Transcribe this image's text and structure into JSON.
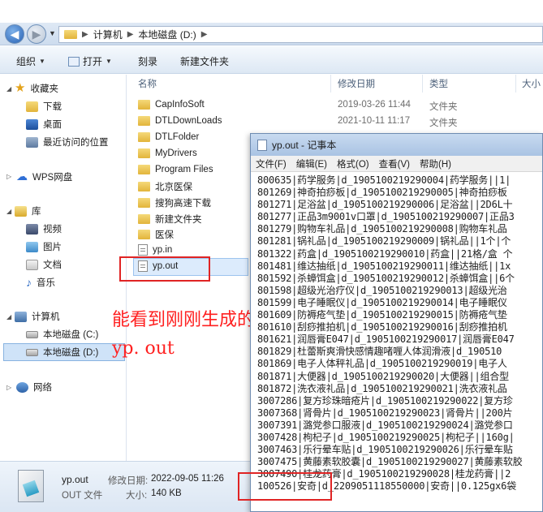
{
  "address": {
    "crumb1": "计算机",
    "crumb2": "本地磁盘 (D:)"
  },
  "toolbar": {
    "organize": "组织",
    "open": "打开",
    "burn": "刻录",
    "new_folder": "新建文件夹"
  },
  "nav": {
    "favorites": "收藏夹",
    "downloads": "下载",
    "desktop": "桌面",
    "recent": "最近访问的位置",
    "wps": "WPS网盘",
    "library": "库",
    "videos": "视频",
    "pictures": "图片",
    "documents": "文档",
    "music": "音乐",
    "computer": "计算机",
    "drive_c": "本地磁盘 (C:)",
    "drive_d": "本地磁盘 (D:)",
    "network": "网络"
  },
  "columns": {
    "name": "名称",
    "date": "修改日期",
    "type": "类型",
    "size": "大小"
  },
  "files": [
    {
      "name": "CapInfoSoft",
      "date": "2019-03-26 11:44",
      "type": "文件夹"
    },
    {
      "name": "DTLDownLoads",
      "date": "2021-10-11 11:17",
      "type": "文件夹"
    },
    {
      "name": "DTLFolder"
    },
    {
      "name": "MyDrivers"
    },
    {
      "name": "Program Files"
    },
    {
      "name": "北京医保"
    },
    {
      "name": "搜狗高速下载"
    },
    {
      "name": "新建文件夹"
    },
    {
      "name": "医保"
    },
    {
      "name": "yp.in"
    },
    {
      "name": "yp.out"
    }
  ],
  "annotation": {
    "line1": "能看到刚刚生成的文件",
    "line2": "yp. out"
  },
  "status": {
    "filename": "yp.out",
    "modified_label": "修改日期:",
    "modified": "2022-09-05 11:26",
    "type": "OUT 文件",
    "size_label": "大小:",
    "size": "140 KB"
  },
  "notepad": {
    "title": "yp.out - 记事本",
    "menu": [
      "文件(F)",
      "编辑(E)",
      "格式(O)",
      "查看(V)",
      "帮助(H)"
    ],
    "lines": [
      "800635|药学服务|d_1905100219290004|药学服务||1|",
      "801269|神奇拍痧板|d_1905100219290005|神奇拍痧板",
      "801271|足浴盆|d_1905100219290006|足浴盆||2D6L十",
      "801277|正品3m9001v口罩|d_1905100219290007|正品3",
      "801279|购物车礼品|d_1905100219290008|购物车礼品",
      "801281|锅礼品|d_1905100219290009|锅礼品||1个|个",
      "801322|药盒|d_1905100219290010|药盒||21格/盒 个",
      "801481|维达抽纸|d_1905100219290011|维达抽纸||1x",
      "801592|杀蟑饵盒|d_1905100219290012|杀蟑饵盒||6个",
      "801598|超级光治疗仪|d_1905100219290013|超级光治",
      "801599|电子睡眠仪|d_1905100219290014|电子睡眠仪",
      "801609|防褥疮气垫|d_1905100219290015|防褥疮气垫",
      "801610|刮痧推拍机|d_1905100219290016|刮痧推拍机",
      "801621|润唇膏E047|d_1905100219290017|润唇膏E047",
      "801829|杜蕾斯爽滑快感情趣啫喱人体润滑液|d_190510",
      "801869|电子人体秤礼品|d_1905100219290019|电子人",
      "801871|大便器|d_1905100219290020|大便器||组合型",
      "801872|洗衣液礼品|d_1905100219290021|洗衣液礼品",
      "3007286|复方珍珠暗疮片|d_1905100219290022|复方珍",
      "3007368|肾骨片|d_1905100219290023|肾骨片||200片",
      "3007391|潞党参口服液|d_1905100219290024|潞党参口",
      "3007428|枸杞子|d_1905100219290025|枸杞子||160g|",
      "3007463|乐行晕车贴|d_1905100219290026|乐行晕车贴",
      "3007475|黄藤素软胶囊|d_1905100219290027|黄藤素软胶",
      "3007490|桂龙药膏|d_1905100219290028|桂龙药膏||2",
      "100526|安奇|d_2209051118550000|安奇||0.125gx6袋"
    ]
  }
}
